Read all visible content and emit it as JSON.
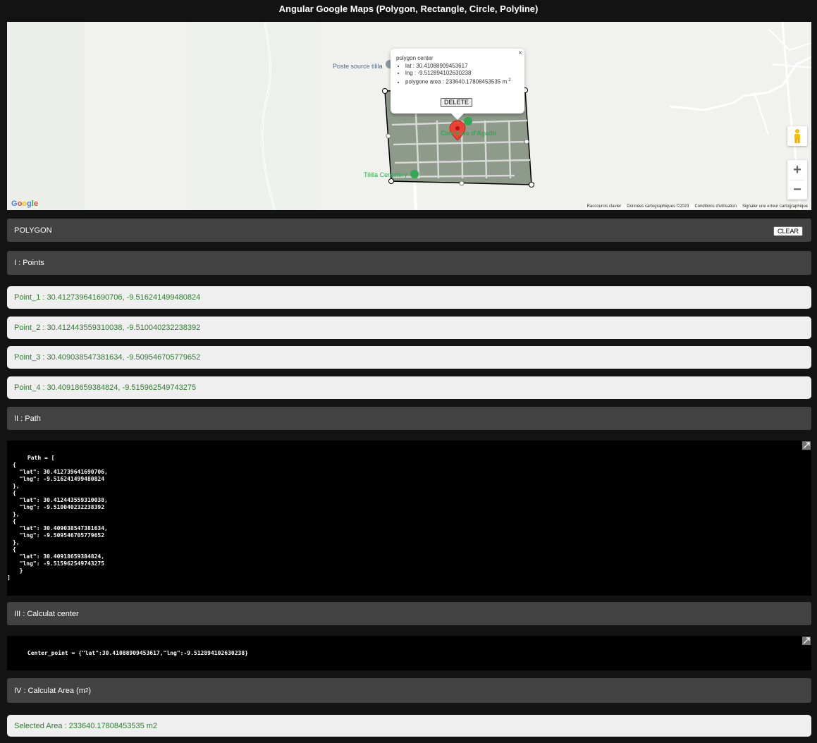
{
  "page": {
    "title": "Angular Google Maps (Polygon, Rectangle, Circle, Polyline)"
  },
  "map": {
    "labels": {
      "poste_source": "Poste source tilila",
      "cimetiere": "Cimetière d'Agadir",
      "tililla_cemetery": "Tililla Cemetery"
    },
    "logo": "Google",
    "attribution": [
      "Raccourcis clavier",
      "Données cartographiques ©2023",
      "Conditions d'utilisation",
      "Signaler une erreur cartographique"
    ],
    "controls": {
      "zoom_in": "+",
      "zoom_out": "−",
      "pegman_icon": "pegman-icon"
    },
    "colors": {
      "polygon_fill": "#8e9a8a",
      "polygon_stroke": "#000000",
      "marker": "#ea4335",
      "poi": "#34a853"
    }
  },
  "infowindow": {
    "title": "polygon center",
    "close": "×",
    "lat_label": "lat : 30.41088909453617",
    "lng_label": "lng : -9.512894102630238",
    "area_label": "polygone area : 233640.17808453535 m",
    "area_sup": "2",
    "delete_label": "DELETE"
  },
  "polygon_bar": {
    "label": "POLYGON",
    "clear_label": "CLEAR"
  },
  "sections": {
    "points": "I : Points",
    "path": "II : Path",
    "center": "III : Calculat center",
    "area": "IV : Calculat Area (m",
    "area_sup": "2",
    "area_close": ")"
  },
  "points": [
    "Point_1 : 30.412739641690706, -9.516241499480824",
    "Point_2 : 30.412443559310038, -9.510040232238392",
    "Point_3 : 30.409038547381634, -9.509546705779652",
    "Point_4 : 30.40918659384824, -9.515962549743275"
  ],
  "path_code": {
    "header": "      Path = [",
    "body": "{\n  \"lat\": 30.412739641690706,\n  \"lng\": -9.516241499480824\n},\n{\n  \"lat\": 30.412443559310038,\n  \"lng\": -9.510040232238392\n},\n{\n  \"lat\": 30.409038547381634,\n  \"lng\": -9.509546705779652\n},\n{\n  \"lat\": 30.40918659384824,\n  \"lng\": -9.515962549743275\n  }",
    "footer": "]"
  },
  "center_code": "      Center_point = {\"lat\":30.41088909453617,\"lng\":-9.512894102630238}",
  "area_result": "Selected Area : 233640.17808453535 m2"
}
